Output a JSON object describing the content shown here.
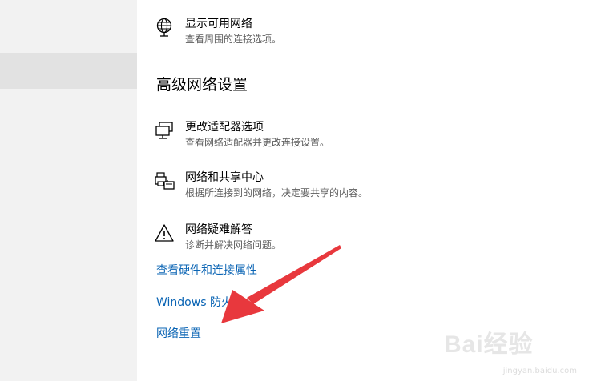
{
  "top_option": {
    "title": "显示可用网络",
    "desc": "查看周围的连接选项。",
    "icon": "globe-network-icon"
  },
  "section": {
    "heading": "高级网络设置"
  },
  "options": [
    {
      "title": "更改适配器选项",
      "desc": "查看网络适配器并更改连接设置。",
      "icon": "adapter-monitor-icon"
    },
    {
      "title": "网络和共享中心",
      "desc": "根据所连接到的网络，决定要共享的内容。",
      "icon": "sharing-printer-icon"
    },
    {
      "title": "网络疑难解答",
      "desc": "诊断并解决网络问题。",
      "icon": "warning-triangle-icon"
    }
  ],
  "links": {
    "hardware": "查看硬件和连接属性",
    "firewall": "Windows 防火墙",
    "reset": "网络重置"
  },
  "colors": {
    "link": "#0a64b4",
    "arrow": "#e8383d",
    "sidebar": "#f2f2f2",
    "sidebar_selected": "#e2e2e2"
  },
  "watermark": {
    "brand": "Bai经验",
    "url": "jingyan.baidu.com"
  }
}
